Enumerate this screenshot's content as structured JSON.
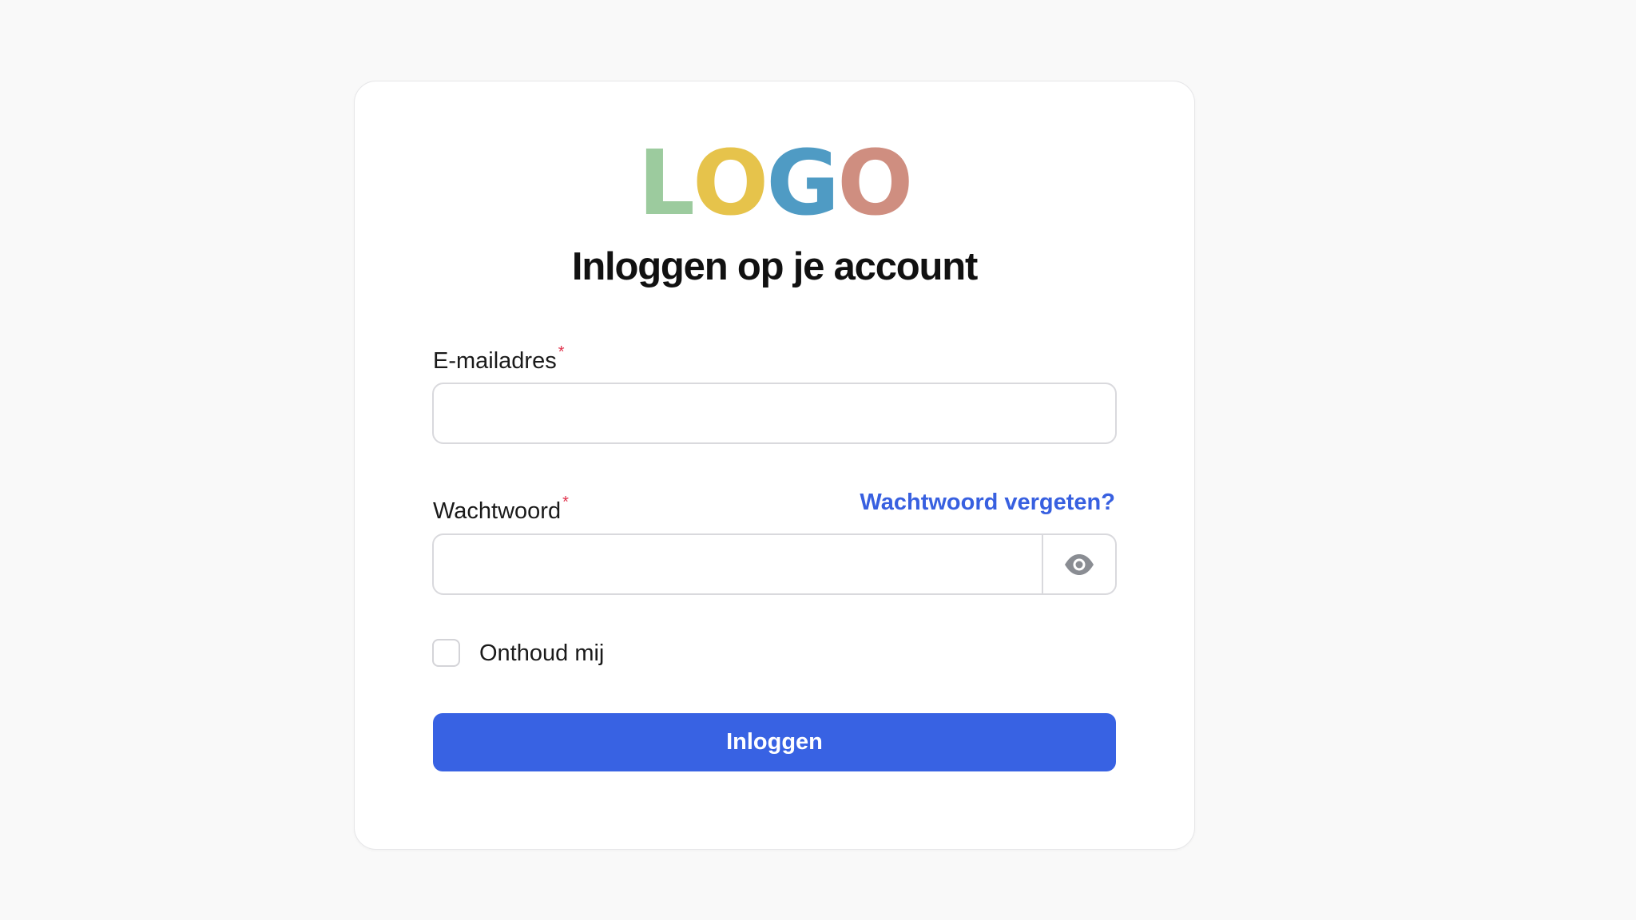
{
  "logo": {
    "letters": [
      {
        "char": "L",
        "color": "#9ccb9e"
      },
      {
        "char": "O",
        "color": "#e6c34b"
      },
      {
        "char": "G",
        "color": "#4f9bc4"
      },
      {
        "char": "O",
        "color": "#cf8e80"
      }
    ]
  },
  "title": "Inloggen op je account",
  "email": {
    "label": "E-mailadres",
    "required_mark": "*",
    "value": "",
    "placeholder": ""
  },
  "password": {
    "label": "Wachtwoord",
    "required_mark": "*",
    "value": "",
    "placeholder": "",
    "forgot_link": "Wachtwoord vergeten?",
    "toggle_icon": "eye-icon"
  },
  "remember": {
    "label": "Onthoud mij",
    "checked": false
  },
  "submit_label": "Inloggen",
  "colors": {
    "accent": "#3862e3",
    "link": "#3860e0",
    "required": "#e0314b",
    "background": "#f9f9f9"
  }
}
